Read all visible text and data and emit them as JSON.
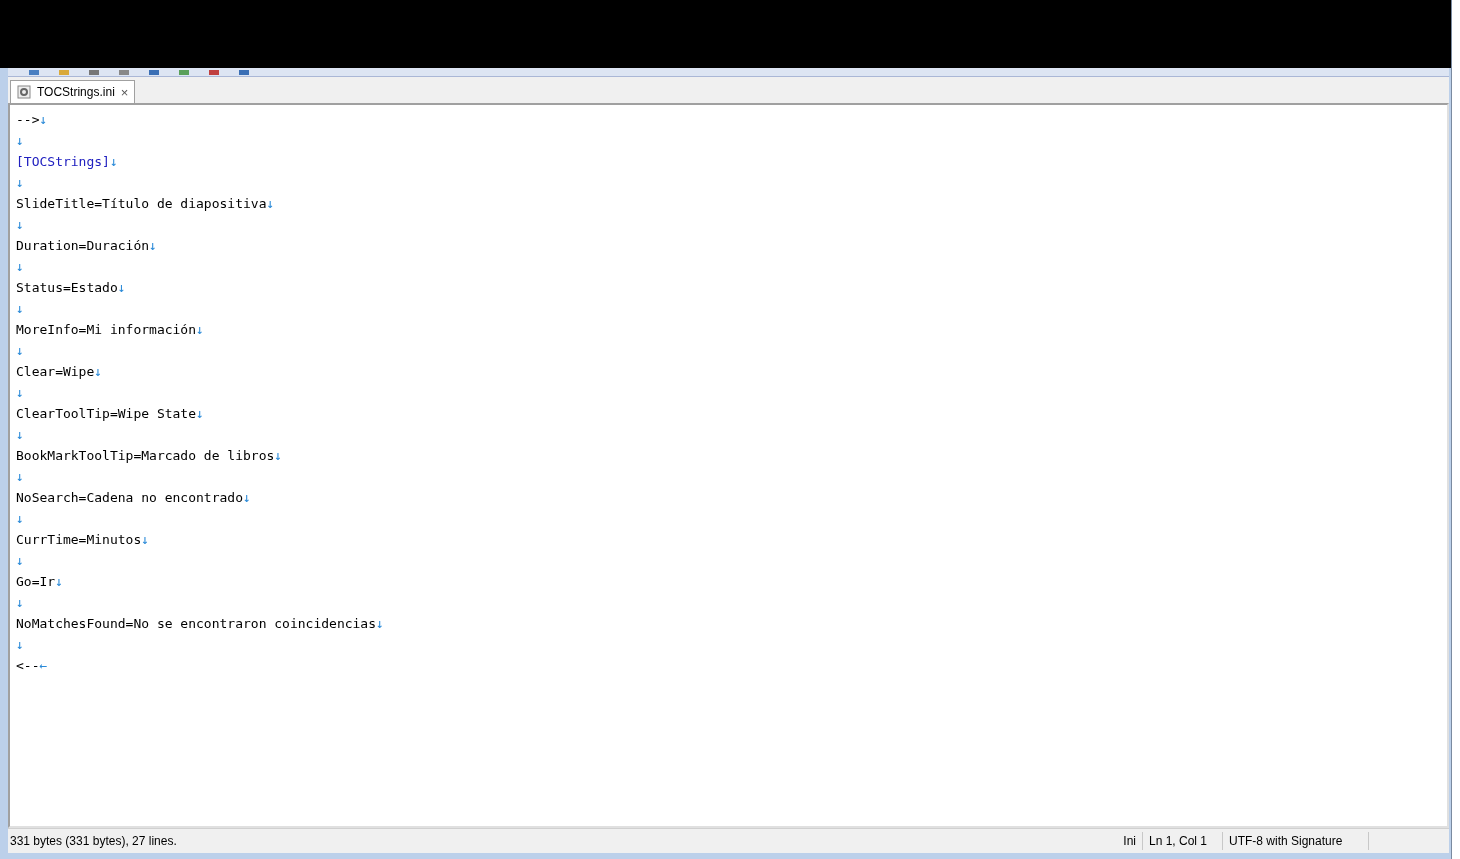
{
  "tab": {
    "title": "TOCStrings.ini",
    "close": "×",
    "selected": true
  },
  "lines": [
    {
      "kind": "text",
      "text": "-->",
      "eol": "↓"
    },
    {
      "kind": "blank",
      "eol": "↓"
    },
    {
      "kind": "section",
      "text": "[TOCStrings]",
      "eol": "↓"
    },
    {
      "kind": "blank",
      "eol": "↓"
    },
    {
      "kind": "text",
      "text": "SlideTitle=Título de diapositiva",
      "eol": "↓"
    },
    {
      "kind": "blank",
      "eol": "↓"
    },
    {
      "kind": "text",
      "text": "Duration=Duración",
      "eol": "↓"
    },
    {
      "kind": "blank",
      "eol": "↓"
    },
    {
      "kind": "text",
      "text": "Status=Estado",
      "eol": "↓"
    },
    {
      "kind": "blank",
      "eol": "↓"
    },
    {
      "kind": "text",
      "text": "MoreInfo=Mi información",
      "eol": "↓"
    },
    {
      "kind": "blank",
      "eol": "↓"
    },
    {
      "kind": "text",
      "text": "Clear=Wipe",
      "eol": "↓"
    },
    {
      "kind": "blank",
      "eol": "↓"
    },
    {
      "kind": "text",
      "text": "ClearToolTip=Wipe State",
      "eol": "↓"
    },
    {
      "kind": "blank",
      "eol": "↓"
    },
    {
      "kind": "text",
      "text": "BookMarkToolTip=Marcado de libros",
      "eol": "↓"
    },
    {
      "kind": "blank",
      "eol": "↓"
    },
    {
      "kind": "text",
      "text": "NoSearch=Cadena no encontrado",
      "eol": "↓"
    },
    {
      "kind": "blank",
      "eol": "↓"
    },
    {
      "kind": "text",
      "text": "CurrTime=Minutos",
      "eol": "↓"
    },
    {
      "kind": "blank",
      "eol": "↓"
    },
    {
      "kind": "text",
      "text": "Go=Ir",
      "eol": "↓"
    },
    {
      "kind": "blank",
      "eol": "↓"
    },
    {
      "kind": "text",
      "text": "NoMatchesFound=No se encontraron coincidencias",
      "eol": "↓"
    },
    {
      "kind": "blank",
      "eol": "↓"
    },
    {
      "kind": "text",
      "text": "<--",
      "eol": "←"
    }
  ],
  "status_bar": {
    "info": "331 bytes (331 bytes), 27 lines.",
    "syntax": "Ini",
    "position": "Ln 1, Col 1",
    "encoding": "UTF-8 with Signature"
  }
}
